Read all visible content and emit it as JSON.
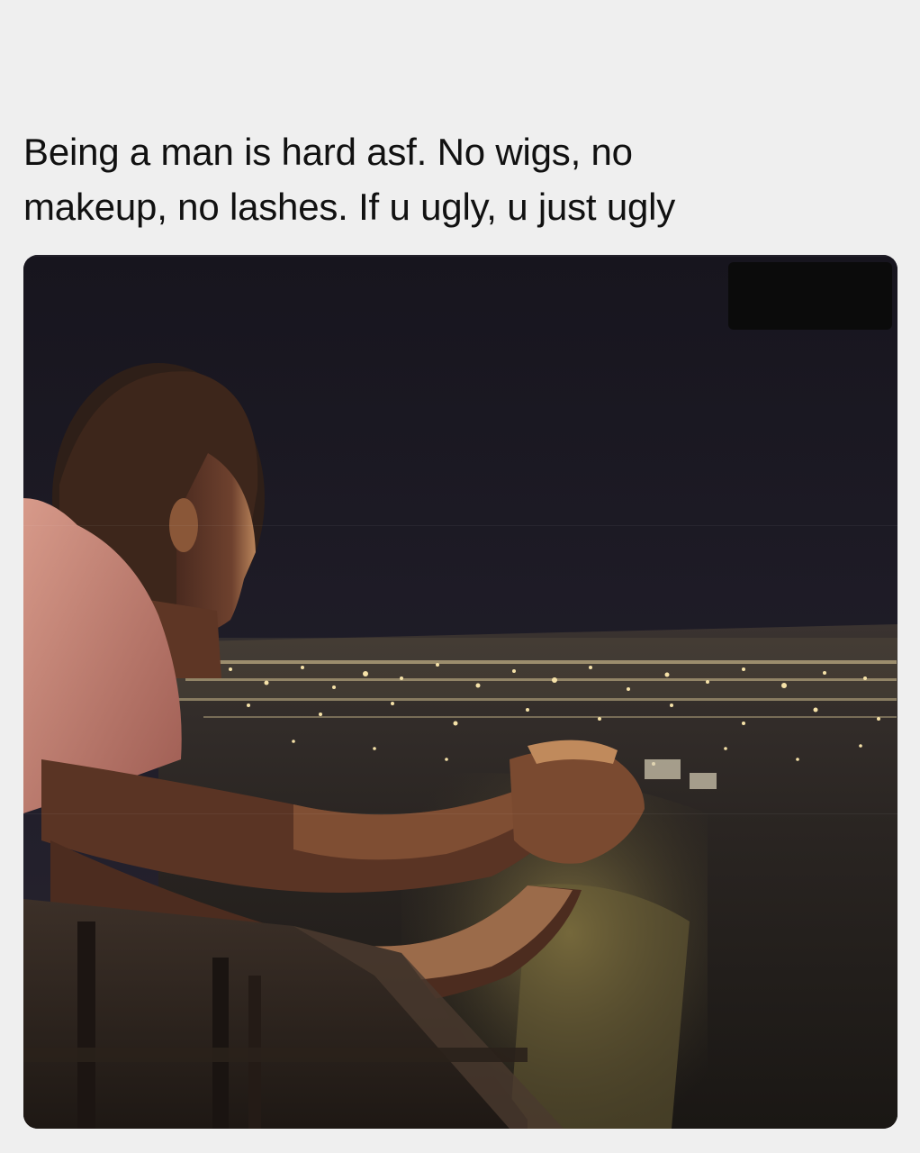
{
  "post": {
    "caption": "Being a man is hard asf. No wigs, no\nmakeup, no lashes. If u ugly, u just ugly"
  },
  "photo": {
    "scene": "man-leaning-on-railing-overlooking-city-lights-at-night",
    "colors": {
      "sky": "#1c1a26",
      "city_glow": "#f3d9a0",
      "shirt": "#c98476",
      "skin": "#6a3e2c",
      "redaction": "#0b0b0b"
    }
  }
}
